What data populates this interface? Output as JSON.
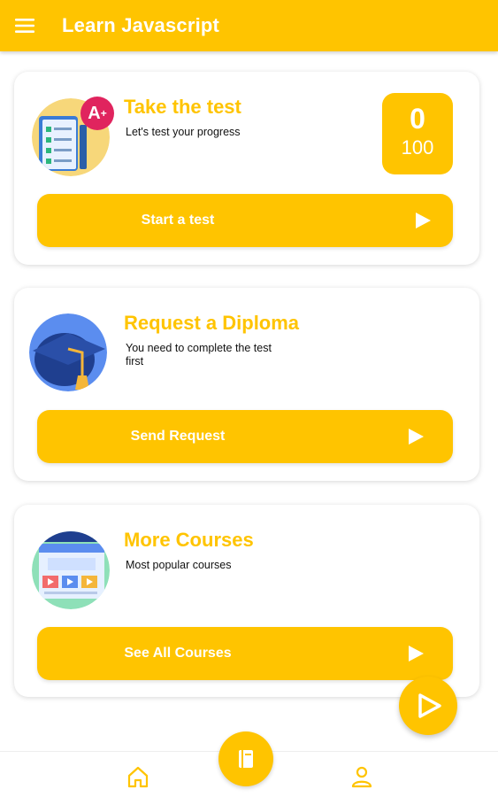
{
  "app": {
    "title": "Learn Javascript",
    "accent_color": "#FFC400",
    "menu_icon": "hamburger-menu-icon"
  },
  "cards": [
    {
      "id": "test",
      "title": "Take the test",
      "subtitle": "Let's test your progress",
      "illustration": "test-checklist-icon",
      "score": {
        "value": "0",
        "max": "100"
      },
      "button": {
        "label": "Start a test",
        "icon": "play-arrow-icon"
      }
    },
    {
      "id": "diploma",
      "title": "Request a Diploma",
      "subtitle": "You need to complete the test first",
      "illustration": "graduation-cap-icon",
      "button": {
        "label": "Send Request",
        "icon": "play-arrow-icon"
      }
    },
    {
      "id": "courses",
      "title": "More Courses",
      "subtitle": "Most popular courses",
      "illustration": "courses-browser-icon",
      "button": {
        "label": "See All Courses",
        "icon": "play-arrow-icon"
      }
    }
  ],
  "fab": {
    "icon": "play-icon"
  },
  "bottom_nav": [
    {
      "id": "home",
      "icon": "home-icon"
    },
    {
      "id": "book",
      "icon": "book-icon"
    },
    {
      "id": "profile",
      "icon": "person-icon"
    }
  ]
}
